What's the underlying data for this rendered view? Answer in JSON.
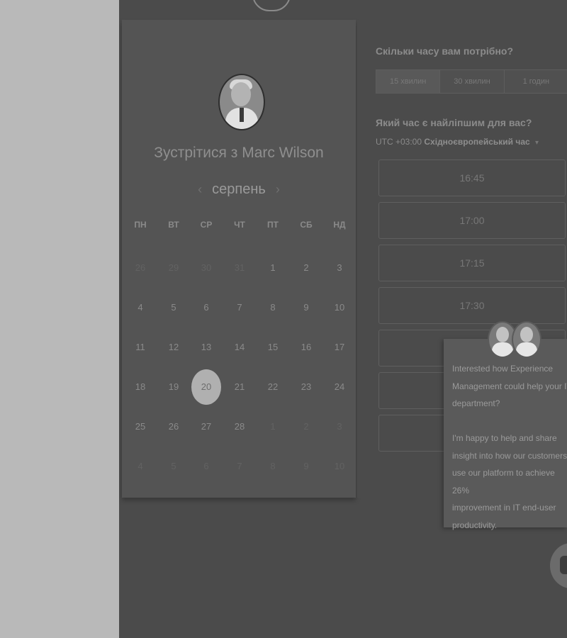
{
  "meeting": {
    "title": "Зустрітися з Marc Wilson",
    "month": "серпень",
    "prev_icon": "chevron-left-icon",
    "next_icon": "chevron-right-icon"
  },
  "calendar": {
    "weekdays": [
      "ПН",
      "ВТ",
      "СР",
      "ЧТ",
      "ПТ",
      "СБ",
      "НД"
    ],
    "weeks": [
      [
        "26",
        "29",
        "30",
        "31",
        "1",
        "2",
        "3"
      ],
      [
        "4",
        "5",
        "6",
        "7",
        "8",
        "9",
        "10"
      ],
      [
        "11",
        "12",
        "13",
        "14",
        "15",
        "16",
        "17"
      ],
      [
        "18",
        "19",
        "20",
        "21",
        "22",
        "23",
        "24"
      ],
      [
        "25",
        "26",
        "27",
        "28",
        "1",
        "2",
        "3"
      ],
      [
        "4",
        "5",
        "6",
        "7",
        "8",
        "9",
        "10"
      ]
    ],
    "selected_day": "20"
  },
  "scheduler": {
    "duration_title": "Скільки часу вам потрібно?",
    "durations": [
      "15 хвилин",
      "30 хвилин",
      "1 годин"
    ],
    "time_title": "Який час є найліпшим для вас?",
    "timezone_offset": "UTC +03:00",
    "timezone_name": "Східноєвропейський час",
    "slots": [
      "16:45",
      "17:00",
      "17:15",
      "17:30"
    ]
  },
  "chat": {
    "message": "Interested how Experience\nManagement could help your IT\ndepartment?\n\nI'm happy to help and share\ninsight into how our customers\nuse our platform to achieve 26%\nimprovement in IT end-user\nproductivity."
  },
  "colors": {
    "overlay": "#4b4b4b",
    "left_bg": "#b9b9b9",
    "selected_day_bg": "#b0b0b0"
  }
}
